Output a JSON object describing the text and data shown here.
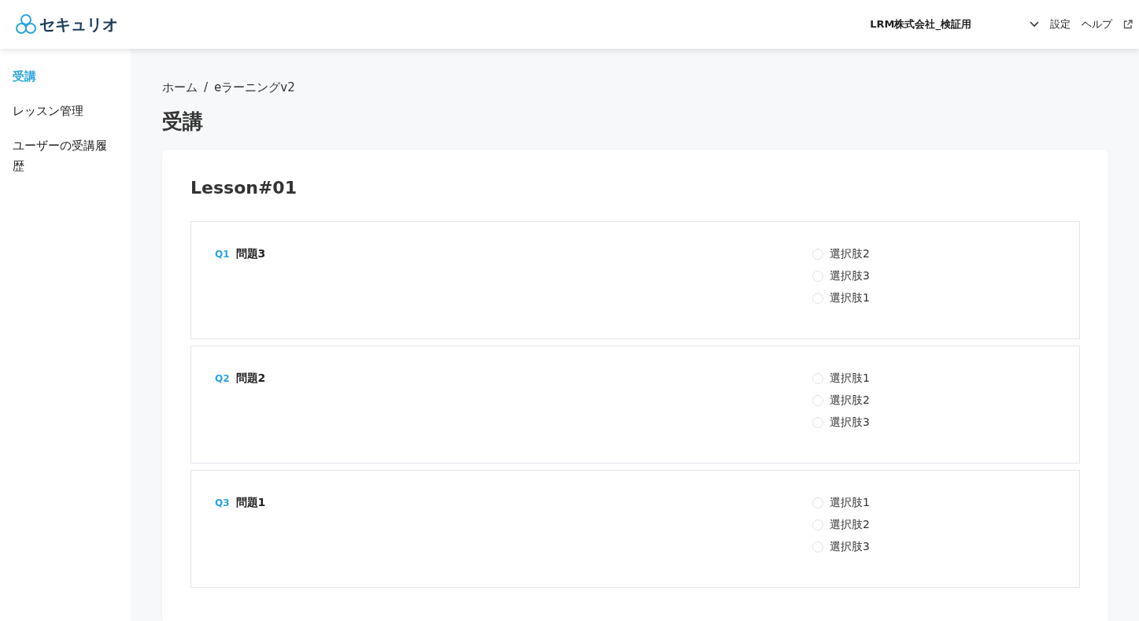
{
  "header": {
    "logo_text": "セキュリオ",
    "company": "LRM株式会社_検証用",
    "settings": "設定",
    "help": "ヘルプ"
  },
  "sidebar": {
    "items": [
      {
        "label": "受講",
        "selected": true
      },
      {
        "label": "レッスン管理",
        "selected": false
      },
      {
        "label": "ユーザーの受講履歴",
        "selected": false
      }
    ]
  },
  "breadcrumb": {
    "items": [
      "ホーム",
      "eラーニングv2"
    ],
    "separator": "/"
  },
  "page_title": "受講",
  "lesson": {
    "title": "Lesson#01",
    "questions": [
      {
        "number": "Q1",
        "text": "問題3",
        "options": [
          {
            "label": "選択肢2",
            "selected": false
          },
          {
            "label": "選択肢3",
            "selected": false
          },
          {
            "label": "選択肢1",
            "selected": false
          }
        ]
      },
      {
        "number": "Q2",
        "text": "問題2",
        "options": [
          {
            "label": "選択肢1",
            "selected": false
          },
          {
            "label": "選択肢2",
            "selected": false
          },
          {
            "label": "選択肢3",
            "selected": false
          }
        ]
      },
      {
        "number": "Q3",
        "text": "問題1",
        "options": [
          {
            "label": "選択肢1",
            "selected": false
          },
          {
            "label": "選択肢2",
            "selected": false
          },
          {
            "label": "選択肢3",
            "selected": false
          }
        ]
      }
    ]
  }
}
